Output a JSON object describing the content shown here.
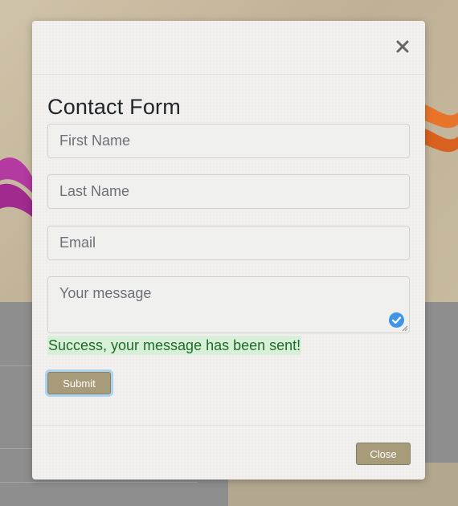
{
  "modal": {
    "title": "Contact Form",
    "close_icon": "close-icon"
  },
  "form": {
    "first_name": {
      "placeholder": "First Name",
      "value": ""
    },
    "last_name": {
      "placeholder": "Last Name",
      "value": ""
    },
    "email": {
      "placeholder": "Email",
      "value": ""
    },
    "message": {
      "placeholder": "Your message",
      "value": ""
    },
    "success_text": "Success, your message has been sent!",
    "submit_label": "Submit"
  },
  "footer": {
    "close_label": "Close"
  },
  "colors": {
    "button": "#a89b7a",
    "success_bg": "#d8efd8",
    "success_text": "#1f6b29",
    "check": "#3f95e8"
  }
}
